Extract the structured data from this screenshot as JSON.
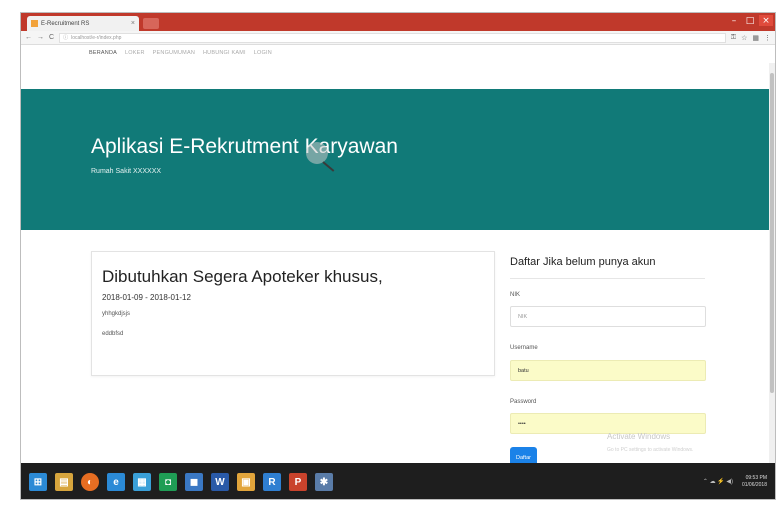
{
  "browser": {
    "tab_title": "E-Recruitment RS",
    "tab_close": "×",
    "address": "localhost/e-r/index.php",
    "nav_symbols": [
      "←",
      "→",
      "C",
      "ⓘ"
    ],
    "toolbar_icons": [
      "key-icon",
      "star-icon",
      "extensions-icon",
      "menu-icon"
    ],
    "window_controls": [
      "–",
      "□",
      "×"
    ]
  },
  "site_nav": {
    "items": [
      {
        "label": "BERANDA",
        "active": true
      },
      {
        "label": "LOKER",
        "active": false
      },
      {
        "label": "PENGUMUMAN",
        "active": false
      },
      {
        "label": "HUBUNGI KAMI",
        "active": false
      },
      {
        "label": "LOGIN",
        "active": false
      }
    ]
  },
  "hero": {
    "title": "Aplikasi E-Rekrutment Karyawan",
    "subtitle": "Rumah Sakit XXXXXX",
    "background": "#117a78"
  },
  "job": {
    "title": "Dibutuhkan Segera Apoteker khusus,",
    "date_range": "2018-01-09 - 2018-01-12",
    "line1": "yhhgkdjsjs",
    "line2": "eddbfsd"
  },
  "register": {
    "heading": "Daftar Jika belum punya akun",
    "nik_label": "NIK",
    "nik_placeholder": "NIK",
    "username_label": "Username",
    "username_value": "batu",
    "password_label": "Password",
    "password_value": "••••",
    "submit_label": "Daftar",
    "button_color": "#1b82e8"
  },
  "windows_watermark": {
    "title": "Activate Windows",
    "subtitle": "Go to PC settings to activate Windows."
  },
  "taskbar": {
    "icons": [
      {
        "name": "windows-start-icon",
        "color": "#2b8ad6",
        "glyph": "⊞"
      },
      {
        "name": "file-explorer-icon",
        "color": "#d7a53d",
        "glyph": "▤"
      },
      {
        "name": "firefox-icon",
        "color": "#e66d22",
        "glyph": "◐"
      },
      {
        "name": "ie-icon",
        "color": "#2b8ad6",
        "glyph": "e"
      },
      {
        "name": "photos-icon",
        "color": "#3aa0d8",
        "glyph": "▦"
      },
      {
        "name": "store-icon",
        "color": "#1f9d55",
        "glyph": "◘"
      },
      {
        "name": "media-icon",
        "color": "#3a78c4",
        "glyph": "◼"
      },
      {
        "name": "word-icon",
        "color": "#2a5aa8",
        "glyph": "W"
      },
      {
        "name": "folder-icon",
        "color": "#e2a53b",
        "glyph": "▣"
      },
      {
        "name": "remote-icon",
        "color": "#2f7fd1",
        "glyph": "R"
      },
      {
        "name": "powerpoint-icon",
        "color": "#c9432c",
        "glyph": "P"
      },
      {
        "name": "settings-icon",
        "color": "#5a7ca8",
        "glyph": "✱"
      }
    ],
    "time": "09:53 PM",
    "date": "01/06/2018"
  }
}
